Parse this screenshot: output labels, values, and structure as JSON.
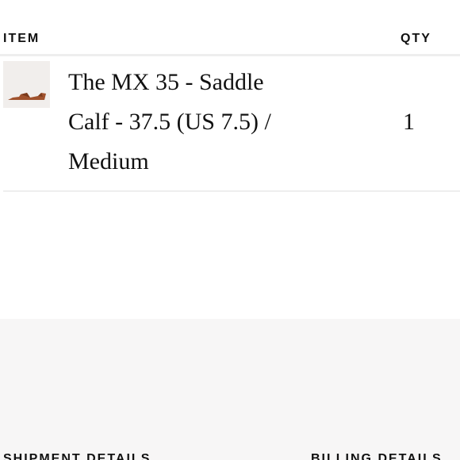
{
  "table": {
    "item_header": "ITEM",
    "qty_header": "QTY",
    "rows": [
      {
        "name": "The MX 35 - Saddle Calf - 37.5 (US 7.5) / Medium",
        "qty": "1",
        "thumbnail_icon": "sandal-icon"
      }
    ]
  },
  "sections": {
    "shipment_label": "SHIPMENT DETAILS",
    "billing_label": "BILLING DETAILS"
  },
  "colors": {
    "divider": "#eeeeee",
    "panel_background": "#f7f6f6",
    "product_leather": "#a0522d"
  }
}
